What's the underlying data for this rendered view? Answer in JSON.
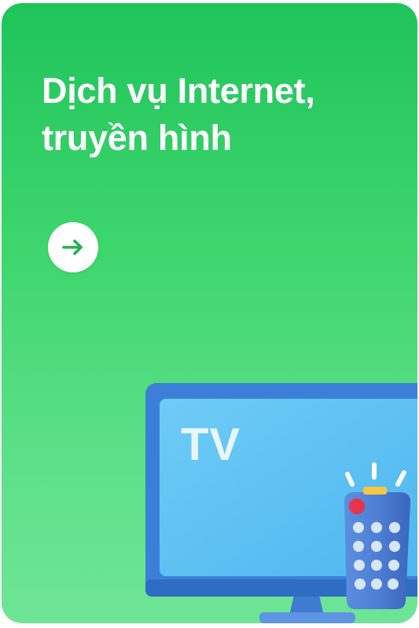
{
  "card": {
    "title_line1": "Dịch vụ Internet,",
    "title_line2": "truyền hình",
    "arrow_button": {
      "icon": "arrow-right-icon",
      "accent": "#22b14c"
    },
    "illustration": {
      "tv_label": "TV",
      "colors": {
        "frame": "#3c7fd8",
        "screen": "#62c3f4",
        "remote_power": "#e8334a"
      }
    }
  }
}
